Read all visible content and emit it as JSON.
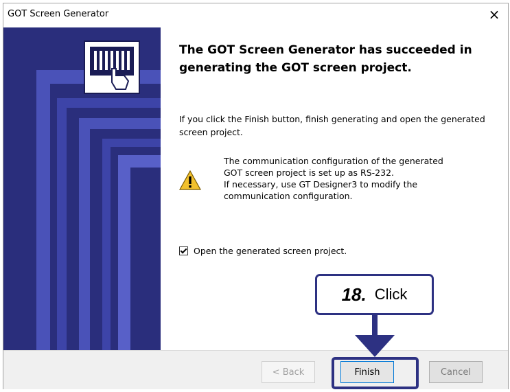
{
  "window": {
    "title": "GOT Screen Generator",
    "close_glyph": "×"
  },
  "content": {
    "heading": "The GOT Screen Generator has succeeded in generating the GOT screen project.",
    "body": "If you click the Finish button, finish generating and open the generated screen project.",
    "warning": {
      "icon": "warning-icon",
      "text": "The communication configuration of the generated\nGOT screen project is set up as RS-232.\nIf necessary, use GT Designer3 to modify the\ncommunication configuration."
    },
    "checkbox": {
      "label": "Open the generated screen project.",
      "checked": true
    }
  },
  "buttons": {
    "back": "< Back",
    "finish": "Finish",
    "cancel": "Cancel"
  },
  "callout": {
    "step": "18.",
    "label": "Click"
  },
  "colors": {
    "brand_navy": "#2d3182",
    "accent_blue": "#0078d7"
  }
}
